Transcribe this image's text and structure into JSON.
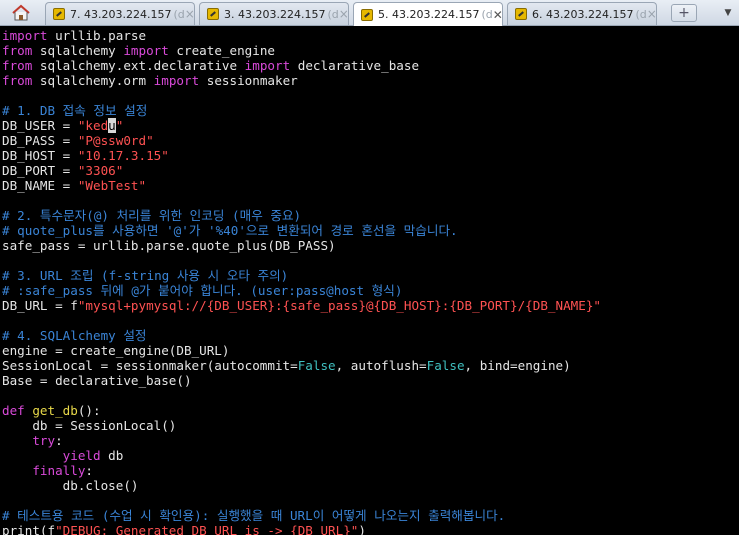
{
  "tabs": [
    {
      "label": "7. 43.203.224.157",
      "suffix": "(d",
      "close": "×"
    },
    {
      "label": "3. 43.203.224.157",
      "suffix": "(d",
      "close": "×"
    },
    {
      "label": "5. 43.203.224.157",
      "suffix": "(d",
      "close": "✕"
    },
    {
      "label": "6. 43.203.224.157",
      "suffix": "(d",
      "close": "×"
    }
  ],
  "new_tab_label": "+",
  "tab_menu_label": "▼",
  "colors": {
    "keyword": "#d94ad9",
    "string": "#ff5252",
    "comment": "#3a84d6",
    "constant": "#3fbfbf",
    "function": "#e8d94a",
    "text": "#e6e6e6"
  },
  "code": {
    "l1": {
      "kw": "import",
      "t": " urllib.parse"
    },
    "l2": {
      "kw1": "from",
      "t1": " sqlalchemy ",
      "kw2": "import",
      "t2": " create_engine"
    },
    "l3": {
      "kw1": "from",
      "t1": " sqlalchemy.ext.declarative ",
      "kw2": "import",
      "t2": " declarative_base"
    },
    "l4": {
      "kw1": "from",
      "t1": " sqlalchemy.orm ",
      "kw2": "import",
      "t2": " sessionmaker"
    },
    "l6": {
      "c": "# 1. DB 접속 정보 설정"
    },
    "l7": {
      "t": "DB_USER = ",
      "s1": "\"ked",
      "cur": "u",
      "s2": "\""
    },
    "l8": {
      "t": "DB_PASS = ",
      "s": "\"P@ssw0rd\""
    },
    "l9": {
      "t": "DB_HOST = ",
      "s": "\"10.17.3.15\""
    },
    "l10": {
      "t": "DB_PORT = ",
      "s": "\"3306\""
    },
    "l11": {
      "t": "DB_NAME = ",
      "s": "\"WebTest\""
    },
    "l13": {
      "c": "# 2. 특수문자(@) 처리를 위한 인코딩 (매우 중요)"
    },
    "l14": {
      "c": "# quote_plus를 사용하면 '@'가 '%40'으로 변환되어 경로 혼선을 막습니다."
    },
    "l15": {
      "t": "safe_pass = urllib.parse.quote_plus(DB_PASS)"
    },
    "l17": {
      "c": "# 3. URL 조립 (f-string 사용 시 오타 주의)"
    },
    "l18": {
      "c": "# :safe_pass 뒤에 @가 붙어야 합니다. (user:pass@host 형식)"
    },
    "l19": {
      "t": "DB_URL = f",
      "s": "\"mysql+pymysql://{DB_USER}:{safe_pass}@{DB_HOST}:{DB_PORT}/{DB_NAME}\""
    },
    "l21": {
      "c": "# 4. SQLAlchemy 설정"
    },
    "l22": {
      "t": "engine = create_engine(DB_URL)"
    },
    "l23": {
      "t1": "SessionLocal = sessionmaker(autocommit=",
      "c1": "False",
      "t2": ", autoflush=",
      "c2": "False",
      "t3": ", bind=engine)"
    },
    "l24": {
      "t": "Base = declarative_base()"
    },
    "l26": {
      "kw": "def",
      "sp": " ",
      "fn": "get_db",
      "t": "():"
    },
    "l27": {
      "t": "    db = SessionLocal()"
    },
    "l28": {
      "ind": "    ",
      "kw": "try",
      "t": ":"
    },
    "l29": {
      "ind": "        ",
      "kw": "yield",
      "t": " db"
    },
    "l30": {
      "ind": "    ",
      "kw": "finally",
      "t": ":"
    },
    "l31": {
      "t": "        db.close()"
    },
    "l33": {
      "c": "# 테스트용 코드 (수업 시 확인용): 실행했을 때 URL이 어떻게 나오는지 출력해봅니다."
    },
    "l34": {
      "t1": "print(f",
      "s": "\"DEBUG: Generated DB URL is -> {DB_URL}\"",
      "t2": ")"
    }
  }
}
